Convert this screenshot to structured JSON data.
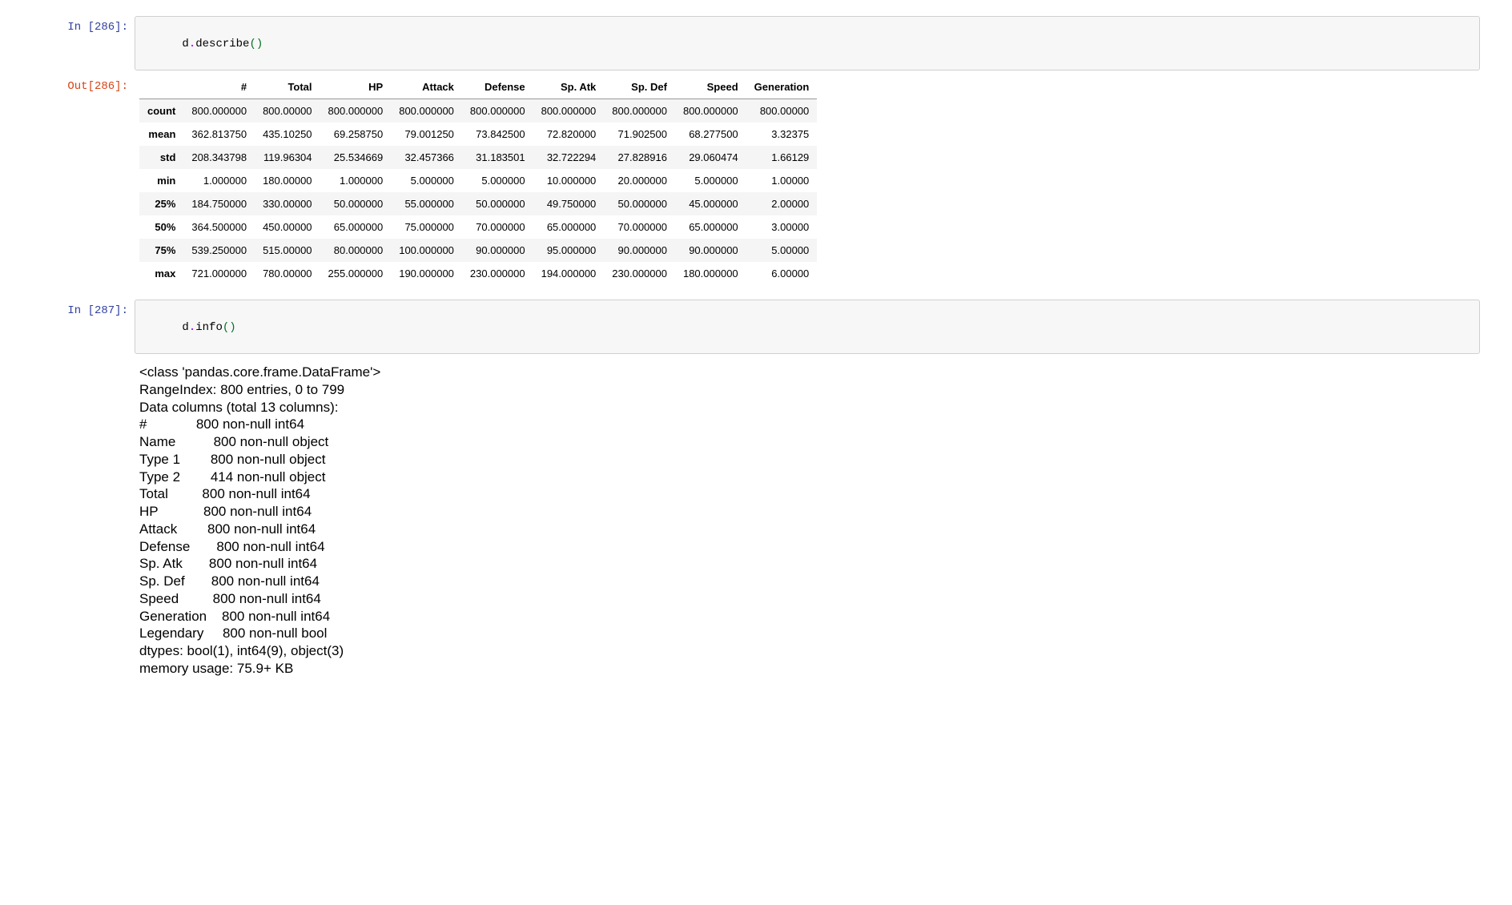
{
  "cells": {
    "c286": {
      "in_prompt": "In [286]:",
      "out_prompt": "Out[286]:",
      "code_ident": "d",
      "code_dot": ".",
      "code_method": "describe",
      "code_paren": "()",
      "table": {
        "columns": [
          "",
          "#",
          "Total",
          "HP",
          "Attack",
          "Defense",
          "Sp. Atk",
          "Sp. Def",
          "Speed",
          "Generation"
        ],
        "rows": [
          [
            "count",
            "800.000000",
            "800.00000",
            "800.000000",
            "800.000000",
            "800.000000",
            "800.000000",
            "800.000000",
            "800.000000",
            "800.00000"
          ],
          [
            "mean",
            "362.813750",
            "435.10250",
            "69.258750",
            "79.001250",
            "73.842500",
            "72.820000",
            "71.902500",
            "68.277500",
            "3.32375"
          ],
          [
            "std",
            "208.343798",
            "119.96304",
            "25.534669",
            "32.457366",
            "31.183501",
            "32.722294",
            "27.828916",
            "29.060474",
            "1.66129"
          ],
          [
            "min",
            "1.000000",
            "180.00000",
            "1.000000",
            "5.000000",
            "5.000000",
            "10.000000",
            "20.000000",
            "5.000000",
            "1.00000"
          ],
          [
            "25%",
            "184.750000",
            "330.00000",
            "50.000000",
            "55.000000",
            "50.000000",
            "49.750000",
            "50.000000",
            "45.000000",
            "2.00000"
          ],
          [
            "50%",
            "364.500000",
            "450.00000",
            "65.000000",
            "75.000000",
            "70.000000",
            "65.000000",
            "70.000000",
            "65.000000",
            "3.00000"
          ],
          [
            "75%",
            "539.250000",
            "515.00000",
            "80.000000",
            "100.000000",
            "90.000000",
            "95.000000",
            "90.000000",
            "90.000000",
            "5.00000"
          ],
          [
            "max",
            "721.000000",
            "780.00000",
            "255.000000",
            "190.000000",
            "230.000000",
            "194.000000",
            "230.000000",
            "180.000000",
            "6.00000"
          ]
        ]
      }
    },
    "c287": {
      "in_prompt": "In [287]:",
      "code_ident": "d",
      "code_dot": ".",
      "code_method": "info",
      "code_paren": "()",
      "text_output": "<class 'pandas.core.frame.DataFrame'>\nRangeIndex: 800 entries, 0 to 799\nData columns (total 13 columns):\n#             800 non-null int64\nName          800 non-null object\nType 1        800 non-null object\nType 2        414 non-null object\nTotal         800 non-null int64\nHP            800 non-null int64\nAttack        800 non-null int64\nDefense       800 non-null int64\nSp. Atk       800 non-null int64\nSp. Def       800 non-null int64\nSpeed         800 non-null int64\nGeneration    800 non-null int64\nLegendary     800 non-null bool\ndtypes: bool(1), int64(9), object(3)\nmemory usage: 75.9+ KB"
    }
  }
}
